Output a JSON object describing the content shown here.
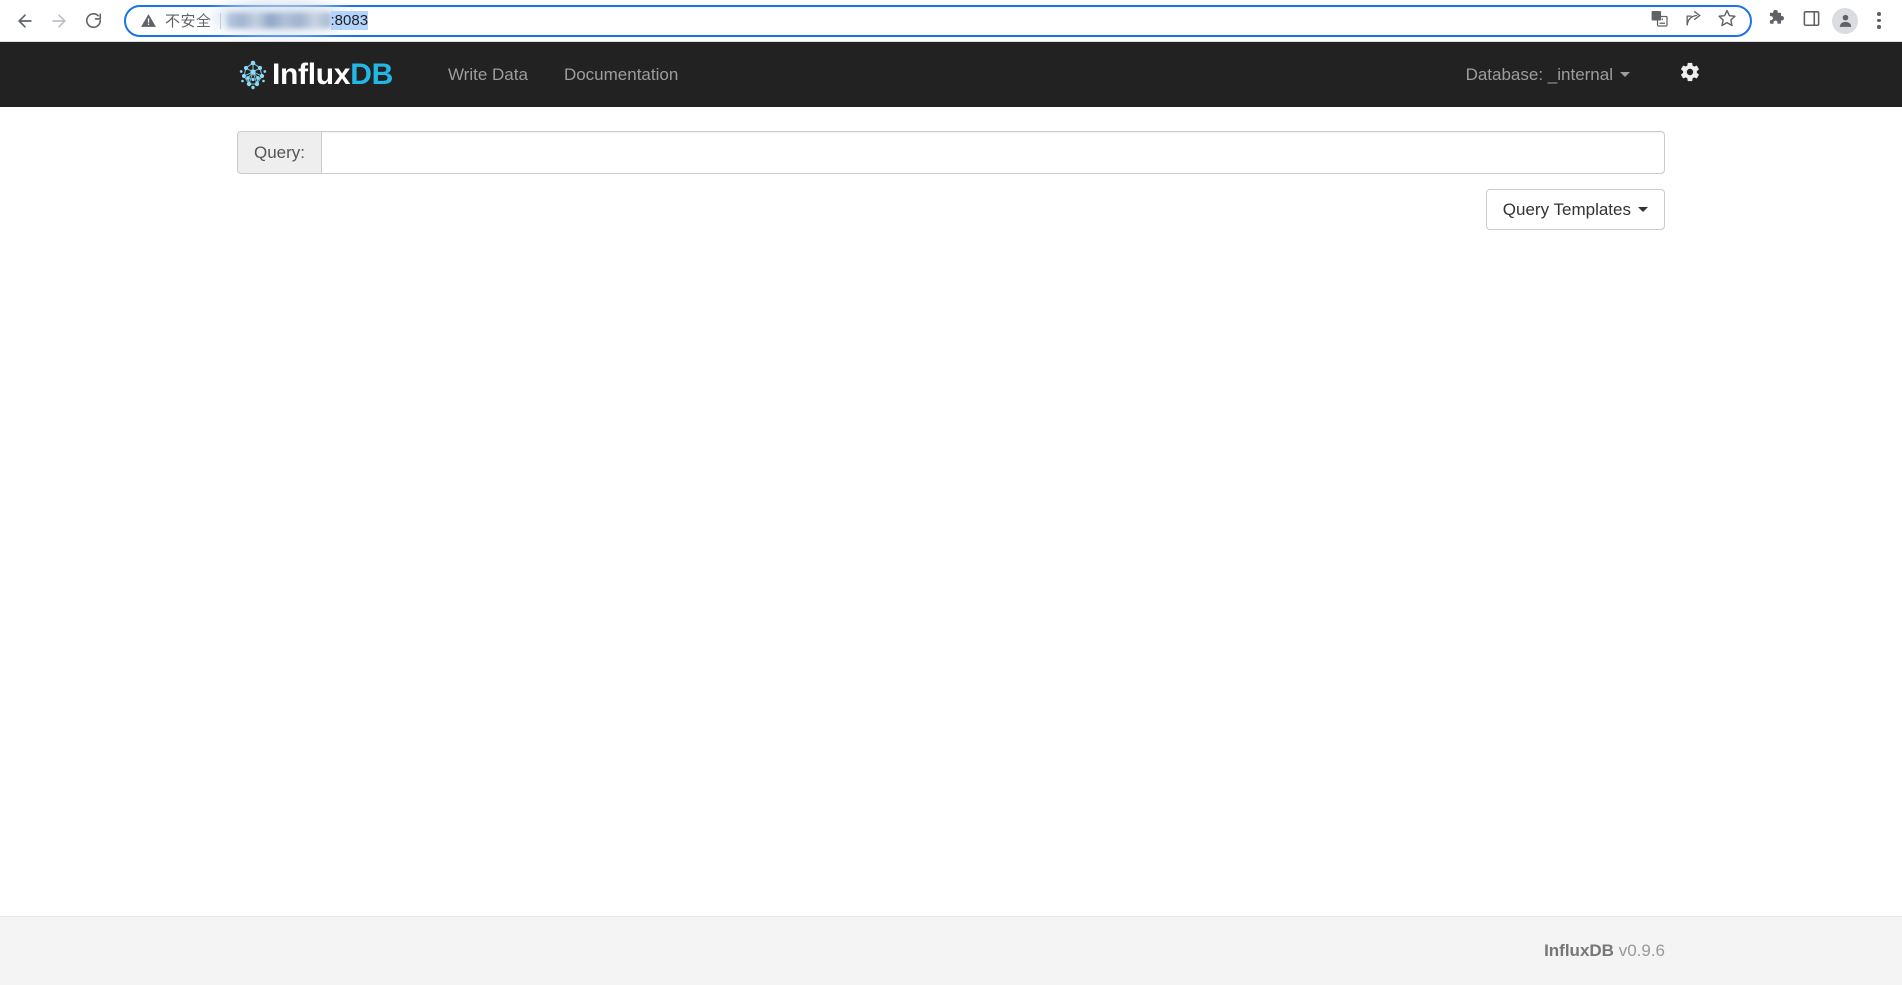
{
  "browser": {
    "back_icon": "back-arrow-icon",
    "forward_icon": "forward-arrow-icon",
    "reload_icon": "reload-icon",
    "security_label": "不安全",
    "security_icon": "warning-triangle-icon",
    "url_host_redacted": "",
    "url_port": ":8083",
    "translate_icon": "translate-icon",
    "share_icon": "share-icon",
    "bookmark_icon": "star-icon",
    "extensions_icon": "puzzle-icon",
    "side_panel_icon": "side-panel-icon",
    "profile_icon": "avatar-icon",
    "menu_icon": "three-dot-menu-icon"
  },
  "navbar": {
    "brand_influx": "Influx",
    "brand_db": "DB",
    "links": [
      {
        "label": "Write Data"
      },
      {
        "label": "Documentation"
      }
    ],
    "database_label": "Database: _internal",
    "settings_icon": "gear-icon"
  },
  "main": {
    "query_addon_label": "Query:",
    "query_value": "",
    "query_placeholder": "",
    "query_templates_label": "Query Templates"
  },
  "footer": {
    "brand": "InfluxDB",
    "version": "v0.9.6"
  },
  "colors": {
    "navbar_bg": "#222222",
    "brand_accent": "#22b8e6",
    "omnibox_focus": "#1a73e8",
    "footer_bg": "#f4f4f4"
  }
}
